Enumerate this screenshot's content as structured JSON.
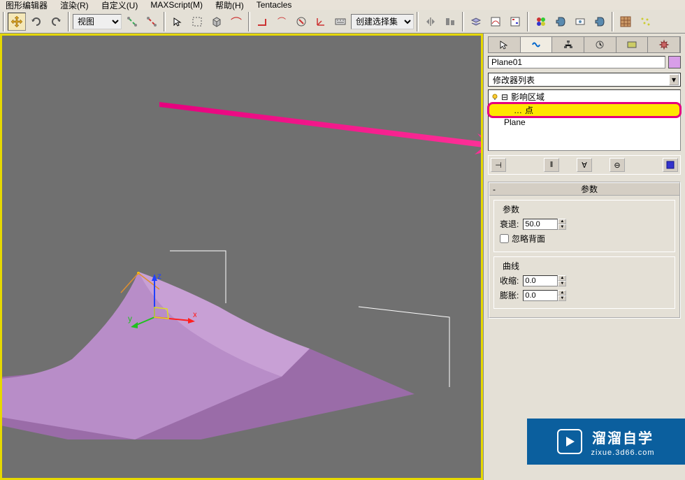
{
  "menu": [
    "图形编辑器",
    "渲染(R)",
    "自定义(U)",
    "MAXScript(M)",
    "帮助(H)",
    "Tentacles"
  ],
  "toolbar": {
    "view_dropdown": "视图",
    "selection_set": "创建选择集"
  },
  "panel": {
    "object_name": "Plane01",
    "modifier_dropdown": "修改器列表",
    "stack": {
      "modifier": "影响区域",
      "subobject": "点",
      "base": "Plane"
    },
    "rollout_title": "参数",
    "params_group": "参数",
    "falloff_label": "衰退:",
    "falloff_value": "50.0",
    "ignore_backface": "忽略背面",
    "curve_group": "曲线",
    "shrink_label": "收缩:",
    "shrink_value": "0.0",
    "expand_label": "膨胀:",
    "expand_value": "0.0"
  },
  "watermark": {
    "title": "溜溜自学",
    "url": "zixue.3d66.com"
  }
}
